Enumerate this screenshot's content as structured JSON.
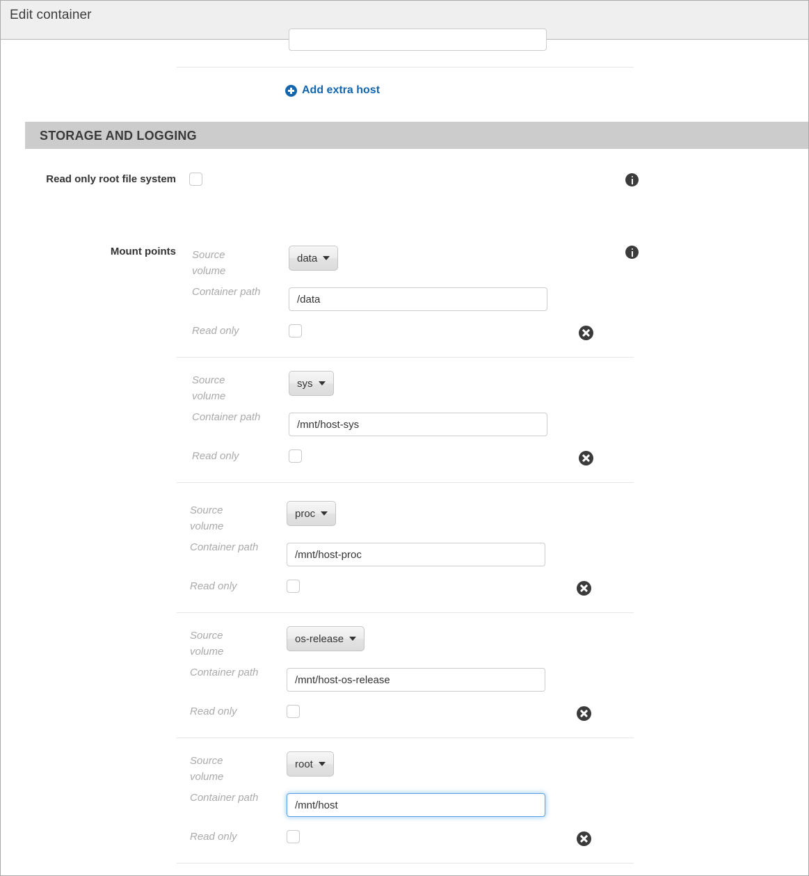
{
  "window": {
    "title": "Edit container"
  },
  "hosts": {
    "add_extra_host_label": "Add extra host",
    "add_icon": "plus-circle-icon"
  },
  "storage_section": {
    "title": "STORAGE AND LOGGING",
    "read_only_root": {
      "label": "Read only root file system",
      "checked": false,
      "info_icon": "info-circle-icon"
    },
    "mount_points": {
      "label": "Mount points",
      "info_icon": "info-circle-icon",
      "sub_labels": {
        "source_volume": "Source volume",
        "container_path": "Container path",
        "read_only": "Read only"
      },
      "remove_icon": "remove-circle-icon",
      "rows": [
        {
          "source_volume": "data",
          "container_path": "/data",
          "read_only": false,
          "focused": false
        },
        {
          "source_volume": "sys",
          "container_path": "/mnt/host-sys",
          "read_only": false,
          "focused": false
        },
        {
          "source_volume": "proc",
          "container_path": "/mnt/host-proc",
          "read_only": false,
          "focused": false
        },
        {
          "source_volume": "os-release",
          "container_path": "/mnt/host-os-release",
          "read_only": false,
          "focused": false
        },
        {
          "source_volume": "root",
          "container_path": "/mnt/host",
          "read_only": false,
          "focused": true
        }
      ]
    }
  },
  "colors": {
    "link": "#1366ae",
    "section_bar": "#cccccc",
    "titlebar": "#efefef",
    "icon_dark": "#3b3b3b",
    "focus_blue": "#5a9fe0"
  }
}
